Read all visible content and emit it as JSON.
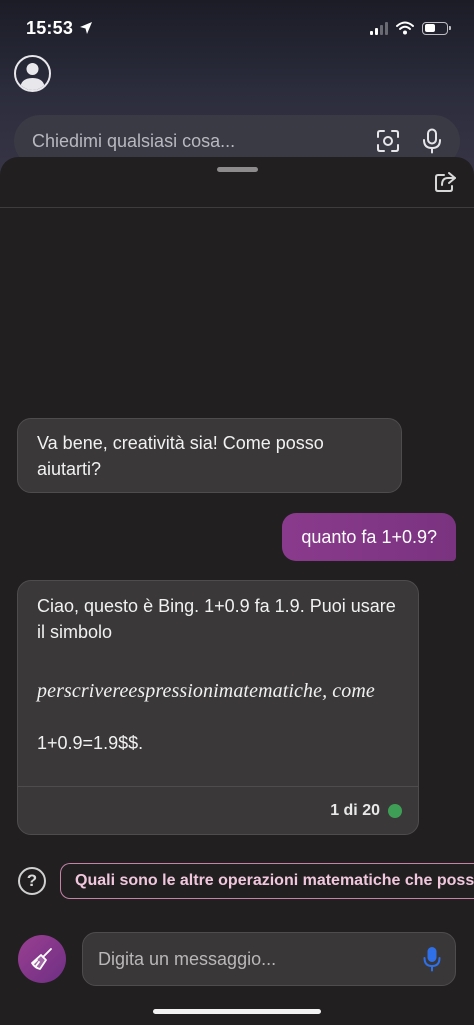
{
  "status_bar": {
    "time": "15:53"
  },
  "search": {
    "placeholder": "Chiedimi qualsiasi cosa..."
  },
  "chat": {
    "bot_message_1": "Va bene, creatività sia! Come posso aiutarti?",
    "user_message": "quanto fa 1+0.9?",
    "bot_message_2": {
      "line1": "Ciao, questo è Bing. 1+0.9 fa 1.9. Puoi usare il simbolo",
      "math_line": "perscrivereespressionimatematiche, come",
      "equation_line": "1+0.9=1.9$$.",
      "counter": "1 di 20"
    }
  },
  "suggestion": {
    "label": "Quali sono le altre operazioni matematiche che possono"
  },
  "composer": {
    "placeholder": "Digita un messaggio..."
  },
  "colors": {
    "accent": "#8a3a8c",
    "status_dot": "#3f9e55",
    "mic_blue": "#2f6fe8"
  }
}
